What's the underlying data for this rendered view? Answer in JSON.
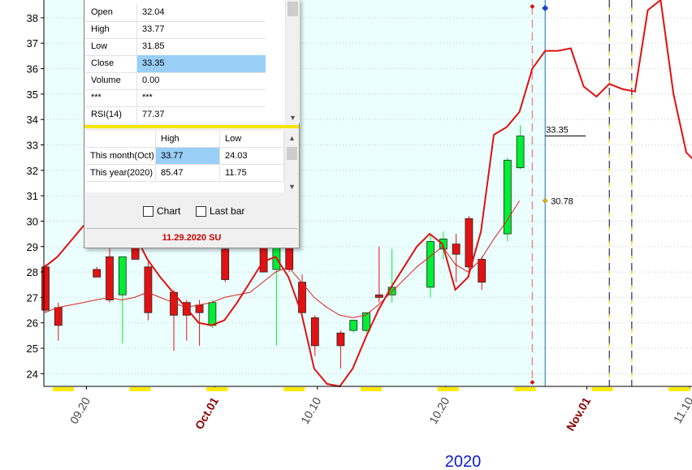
{
  "chart_data": {
    "type": "candlestick",
    "ylim": [
      23.5,
      38.7
    ],
    "yticks": [
      24,
      25,
      26,
      27,
      28,
      29,
      30,
      31,
      32,
      33,
      34,
      35,
      36,
      37,
      38
    ],
    "x_tick_labels": [
      {
        "label": "09.20",
        "index": 3,
        "highlight": false
      },
      {
        "label": "Oct.01",
        "index": 13,
        "highlight": true
      },
      {
        "label": "10.10",
        "index": 21,
        "highlight": false
      },
      {
        "label": "10.20",
        "index": 31,
        "highlight": false
      },
      {
        "label": "Nov.01",
        "index": 42,
        "highlight": true
      },
      {
        "label": "11.10",
        "index": 50,
        "highlight": false
      }
    ],
    "year_label": "2020",
    "last_candle_index": 39,
    "candles": [
      {
        "i": 0,
        "o": 28.2,
        "h": 28.3,
        "l": 26.4,
        "c": 26.5
      },
      {
        "i": 1,
        "o": 26.6,
        "h": 26.8,
        "l": 25.3,
        "c": 25.9
      },
      {
        "i": 4,
        "o": 28.1,
        "h": 28.2,
        "l": 27.8,
        "c": 27.8
      },
      {
        "i": 5,
        "o": 28.6,
        "h": 29.1,
        "l": 26.8,
        "c": 26.9
      },
      {
        "i": 6,
        "o": 27.1,
        "h": 28.6,
        "l": 25.2,
        "c": 28.6
      },
      {
        "i": 7,
        "o": 29.2,
        "h": 29.4,
        "l": 28.5,
        "c": 28.5
      },
      {
        "i": 8,
        "o": 28.2,
        "h": 28.4,
        "l": 26.1,
        "c": 26.4
      },
      {
        "i": 10,
        "o": 27.2,
        "h": 27.3,
        "l": 24.9,
        "c": 26.3
      },
      {
        "i": 11,
        "o": 26.8,
        "h": 26.9,
        "l": 25.3,
        "c": 26.3
      },
      {
        "i": 12,
        "o": 26.7,
        "h": 26.9,
        "l": 25.1,
        "c": 26.4
      },
      {
        "i": 13,
        "o": 25.9,
        "h": 26.9,
        "l": 25.8,
        "c": 26.8
      },
      {
        "i": 14,
        "o": 28.9,
        "h": 29.2,
        "l": 27.6,
        "c": 27.7
      },
      {
        "i": 17,
        "o": 29.1,
        "h": 29.3,
        "l": 28.0,
        "c": 28.0
      },
      {
        "i": 18,
        "o": 28.1,
        "h": 29.3,
        "l": 25.1,
        "c": 29.2
      },
      {
        "i": 19,
        "o": 29.3,
        "h": 29.4,
        "l": 28.0,
        "c": 28.1
      },
      {
        "i": 20,
        "o": 27.6,
        "h": 27.9,
        "l": 26.4,
        "c": 26.4
      },
      {
        "i": 21,
        "o": 26.2,
        "h": 26.3,
        "l": 24.7,
        "c": 25.1
      },
      {
        "i": 23,
        "o": 25.6,
        "h": 25.7,
        "l": 24.2,
        "c": 25.1
      },
      {
        "i": 24,
        "o": 25.7,
        "h": 26.1,
        "l": 25.6,
        "c": 26.1
      },
      {
        "i": 25,
        "o": 25.7,
        "h": 26.4,
        "l": 25.6,
        "c": 26.4
      },
      {
        "i": 26,
        "o": 27.1,
        "h": 29.0,
        "l": 26.8,
        "c": 27.0
      },
      {
        "i": 27,
        "o": 27.1,
        "h": 28.9,
        "l": 26.8,
        "c": 27.4
      },
      {
        "i": 30,
        "o": 27.4,
        "h": 29.5,
        "l": 27.0,
        "c": 29.2
      },
      {
        "i": 31,
        "o": 28.9,
        "h": 29.6,
        "l": 28.5,
        "c": 29.3
      },
      {
        "i": 32,
        "o": 29.1,
        "h": 29.5,
        "l": 27.6,
        "c": 28.7
      },
      {
        "i": 33,
        "o": 30.1,
        "h": 30.2,
        "l": 27.8,
        "c": 28.2
      },
      {
        "i": 34,
        "o": 28.5,
        "h": 28.6,
        "l": 27.3,
        "c": 27.6
      },
      {
        "i": 36,
        "o": 29.5,
        "h": 32.5,
        "l": 29.2,
        "c": 32.4
      },
      {
        "i": 37,
        "o": 32.1,
        "h": 33.77,
        "l": 32.04,
        "c": 33.35
      }
    ],
    "ma_red_values": [
      28.2,
      28.6,
      29.2,
      29.8,
      30.3,
      30.5,
      30.2,
      29.5,
      28.5,
      27.8,
      27.2,
      26.6,
      26.0,
      25.9,
      26.1,
      26.8,
      27.6,
      28.4,
      28.6,
      27.8,
      26.4,
      24.2,
      23.6,
      23.5,
      24.2,
      25.4,
      26.5,
      27.4,
      28.2,
      29.0,
      29.5,
      29.1,
      27.3,
      27.8,
      29.6,
      33.4,
      33.7,
      34.3,
      36.0,
      36.7,
      36.7,
      36.8,
      35.3,
      34.9,
      35.4,
      35.2,
      35.1,
      38.3,
      38.7,
      35.0,
      32.7,
      32.2,
      31.9,
      31.5,
      31.8,
      32.4,
      32.9
    ],
    "ma_thin_values": [
      26.4,
      26.6,
      26.7,
      26.8,
      26.9,
      27.0,
      26.9,
      27.0,
      27.2,
      27.0,
      26.8,
      26.6,
      26.7,
      26.8,
      27.0,
      27.1,
      27.2,
      27.6,
      28.0,
      28.2,
      27.6,
      27.0,
      26.6,
      26.3,
      26.2,
      26.3,
      26.7,
      27.2,
      27.7,
      28.2,
      28.6,
      29.0,
      28.3,
      28.0,
      28.5,
      29.3,
      30.0,
      30.8
    ],
    "last_close": 33.35,
    "last_close_label": "33.35",
    "ma_last_label": "30.78",
    "background_area": "#ebffff",
    "colors": {
      "up": "#00ee33",
      "down": "#e31212",
      "ma": "#e01010",
      "selection": "#99cff7",
      "accent": "#ffeb00"
    }
  },
  "info_window": {
    "quote": {
      "rows": [
        {
          "label": "Open",
          "value": "32.04"
        },
        {
          "label": "High",
          "value": "33.77"
        },
        {
          "label": "Low",
          "value": "31.85"
        },
        {
          "label": "Close",
          "value": "33.35"
        },
        {
          "label": "Volume",
          "value": "0.00"
        },
        {
          "label": "***",
          "value": "***"
        },
        {
          "label": "RSI(14)",
          "value": "77.37"
        }
      ],
      "selected_row": "Close"
    },
    "period": {
      "headers": [
        "",
        "High",
        "Low"
      ],
      "rows": [
        {
          "label": "This month(Oct)",
          "high": "33.77",
          "low": "24.03"
        },
        {
          "label": "This year(2020)",
          "high": "85.47",
          "low": "11.75"
        }
      ]
    },
    "chart_checkbox_label": "Chart",
    "last_bar_checkbox_label": "Last bar",
    "date": "11.29.2020 SU"
  }
}
